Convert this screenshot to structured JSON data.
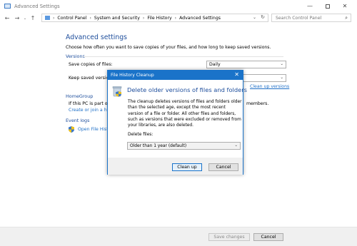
{
  "window": {
    "title": "Advanced Settings",
    "controls": {
      "minimize": "—",
      "maximize": "",
      "close": "✕"
    }
  },
  "nav": {
    "back_icon": "back-arrow-icon",
    "forward_icon": "forward-arrow-icon",
    "up_icon": "up-arrow-icon",
    "breadcrumbs": [
      "Control Panel",
      "System and Security",
      "File History",
      "Advanced Settings"
    ],
    "search_placeholder": "Search Control Panel"
  },
  "main": {
    "title": "Advanced settings",
    "description": "Choose how often you want to save copies of your files, and how long to keep saved versions.",
    "versions": {
      "header": "Versions",
      "save_copies_label": "Save copies of files:",
      "save_copies_value": "Daily",
      "keep_label": "Keep saved versio",
      "cleanup_link": "Clean up versions"
    },
    "homegroup": {
      "header": "HomeGroup",
      "text": "If this PC is part of",
      "members_text": "members.",
      "link": "Create or join a ho"
    },
    "event_logs": {
      "header": "Event logs",
      "link": "Open File Histo"
    }
  },
  "footer": {
    "save_label": "Save changes",
    "cancel_label": "Cancel"
  },
  "dialog": {
    "title": "File History Cleanup",
    "close": "✕",
    "heading": "Delete older versions of files and folders",
    "body": "The cleanup deletes versions of files and folders older than the selected age, except the most recent version of a file or folder. All other files and folders, such as versions that were excluded or removed from your libraries, are also deleted.",
    "delete_files_label": "Delete files:",
    "delete_files_value": "Older than 1 year (default)",
    "cleanup_button": "Clean up",
    "cancel_button": "Cancel"
  },
  "colors": {
    "accent": "#1a73c9",
    "heading": "#1e4e9c",
    "link": "#1e6fc7"
  }
}
